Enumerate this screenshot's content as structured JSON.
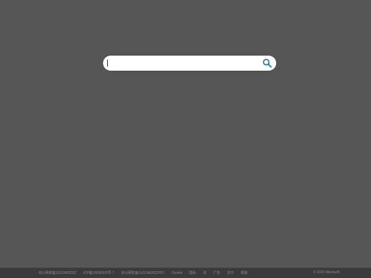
{
  "search": {
    "value": "",
    "icon": "search-icon",
    "icon_color": "#1a6f9f"
  },
  "footer": {
    "links": [
      "京公网安备11010802022",
      "ICP备10036305号-7",
      "京公网安备11010802022657",
      "Cookie",
      "隐私",
      "法",
      "广告",
      "关于",
      "帮助"
    ],
    "copyright": "© 2023 Microsoft"
  },
  "colors": {
    "background": "#565656",
    "footer_background": "#3b3b3b",
    "footer_text": "#8c8c8c"
  }
}
